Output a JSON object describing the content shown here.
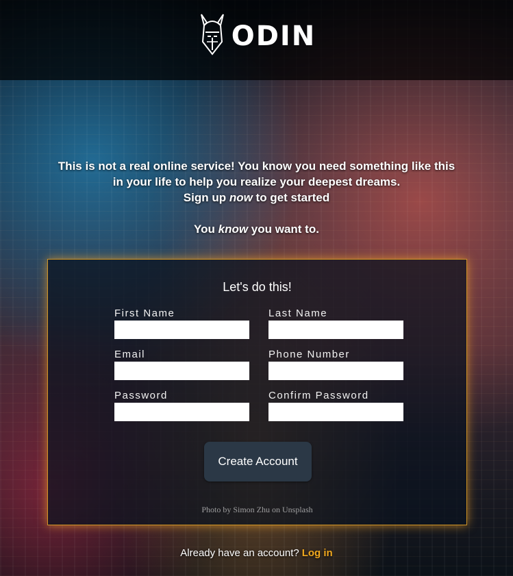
{
  "header": {
    "logo_text": "ODIN",
    "logo_icon": "viking-helmet-icon"
  },
  "intro": {
    "line1": "This is not a real online service! You know you need something like this",
    "line2": "in your life to help you realize your deepest dreams.",
    "line3_a": "Sign up ",
    "line3_em": "now",
    "line3_b": " to get started",
    "line4_a": "You ",
    "line4_em": "know",
    "line4_b": " you want to."
  },
  "form": {
    "title": "Let's do this!",
    "fields": {
      "first_name": {
        "label": "First Name",
        "value": ""
      },
      "last_name": {
        "label": "Last Name",
        "value": ""
      },
      "email": {
        "label": "Email",
        "value": ""
      },
      "phone": {
        "label": "Phone Number",
        "value": ""
      },
      "password": {
        "label": "Password",
        "value": ""
      },
      "confirm_password": {
        "label": "Confirm Password",
        "value": ""
      }
    },
    "submit_label": "Create Account",
    "photo_credit": "Photo by Simon Zhu on Unsplash"
  },
  "footer": {
    "prompt": "Already have an account?",
    "login_label": "Log in"
  },
  "colors": {
    "accent": "#f0a81e",
    "button_bg": "#2b3846",
    "header_bg": "#000000"
  }
}
